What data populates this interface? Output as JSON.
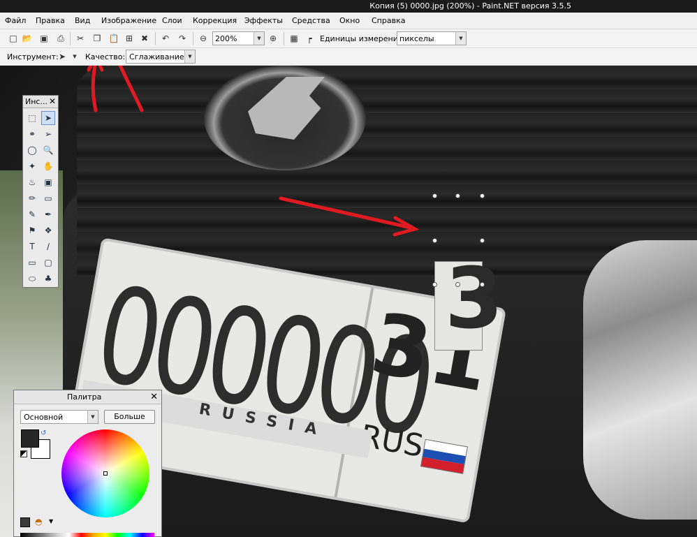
{
  "window": {
    "title": "Копия (5) 0000.jpg (200%) - Paint.NET версия 3.5.5"
  },
  "menu": [
    "Файл",
    "Правка",
    "Вид",
    "Изображение",
    "Слои",
    "Коррекция",
    "Эффекты",
    "Средства",
    "Окно",
    "Справка"
  ],
  "toolbar": {
    "zoom_value": "200%",
    "units_label": "Единицы измерения:",
    "units_value": "пикселы"
  },
  "tool_options": {
    "tool_label": "Инструмент:",
    "quality_label": "Качество:",
    "quality_value": "Сглаживание"
  },
  "tools_panel": {
    "title": "Инс..."
  },
  "palette": {
    "title": "Палитра",
    "mode_value": "Основной",
    "more_label": "Больше",
    "primary_color": "#262626",
    "secondary_color": "#ffffff"
  },
  "image": {
    "plate_number": "000000",
    "plate_region": "31",
    "plate_country": "RUS",
    "plate_strip_text": "RUSSIA",
    "selection_digit": "3"
  },
  "annotations": {
    "arrow_color": "#e11920"
  }
}
